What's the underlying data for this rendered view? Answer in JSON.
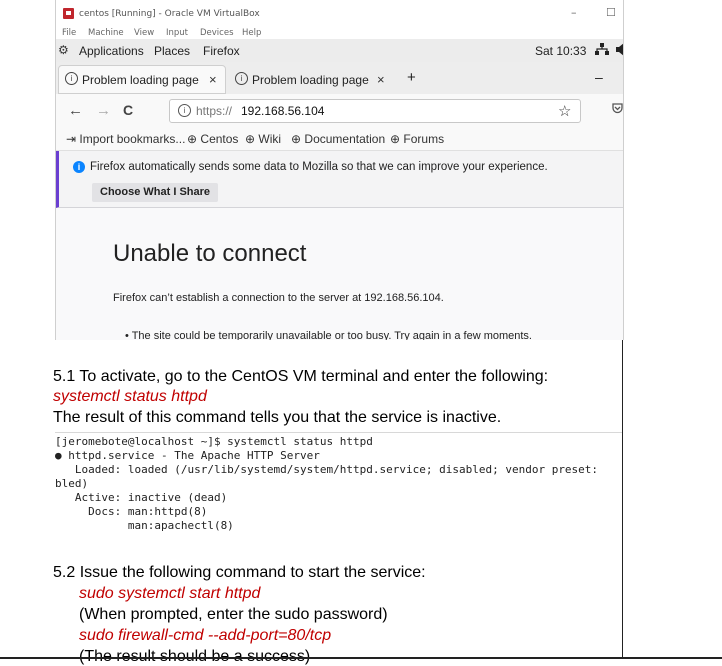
{
  "vbox": {
    "title": "centos [Running] - Oracle VM VirtualBox",
    "minimize": "–",
    "maximize": "☐",
    "menu": [
      "File",
      "Machine",
      "View",
      "Input",
      "Devices",
      "Help"
    ]
  },
  "gnome": {
    "applications": "Applications",
    "places": "Places",
    "firefox": "Firefox",
    "time": "Sat 10:33"
  },
  "tabs": [
    {
      "label": "Problem loading page",
      "close": "×"
    },
    {
      "label": "Problem loading page",
      "close": "×"
    }
  ],
  "new_tab": "+",
  "tab_overflow": "–",
  "nav": {
    "back": "←",
    "forward": "→",
    "reload": "C",
    "star": "☆"
  },
  "url": {
    "scheme": "https://",
    "host": "192.168.56.104"
  },
  "bookmarks": [
    "Import bookmarks...",
    "Centos",
    "Wiki",
    "Documentation",
    "Forums"
  ],
  "notice": {
    "message": "Firefox automatically sends some data to Mozilla so that we can improve your experience.",
    "button": "Choose What I Share"
  },
  "error_page": {
    "title": "Unable to connect",
    "description": "Firefox can’t establish a connection to the server at 192.168.56.104.",
    "bullet": "• The site could be temporarily unavailable or too busy. Try again in a few moments."
  },
  "doc": {
    "step51": "5.1 To activate, go to the CentOS VM terminal and enter the following:",
    "cmd1": "systemctl status httpd",
    "result": "The result of this command tells you that the service is inactive.",
    "step52": "5.2 Issue the following command to start the service:",
    "cmd2": "sudo systemctl start httpd",
    "prompt_note": "(When prompted, enter the sudo password)",
    "cmd3": "sudo firewall-cmd --add-port=80/tcp",
    "success_note": "(The result should be a success)"
  },
  "terminal": [
    "[jeromebote@localhost ~]$ systemctl status httpd",
    "● httpd.service - The Apache HTTP Server",
    "   Loaded: loaded (/usr/lib/systemd/system/httpd.service; disabled; vendor preset:",
    "bled)",
    "   Active: inactive (dead)",
    "     Docs: man:httpd(8)",
    "           man:apachectl(8)"
  ]
}
